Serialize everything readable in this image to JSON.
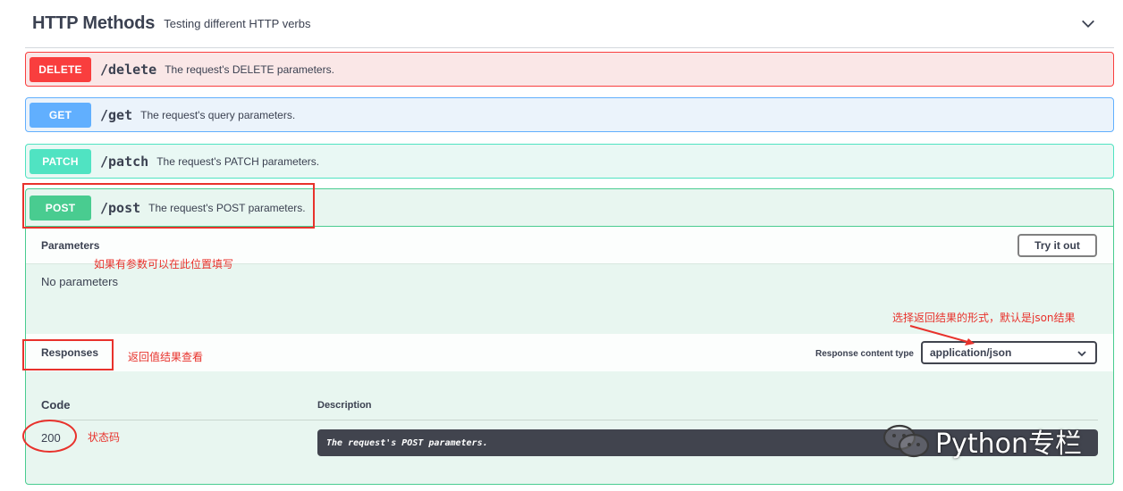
{
  "section": {
    "title": "HTTP Methods",
    "description": "Testing different HTTP verbs"
  },
  "operations": [
    {
      "method": "DELETE",
      "path": "/delete",
      "description": "The request's DELETE parameters.",
      "color": "#f93e3e"
    },
    {
      "method": "GET",
      "path": "/get",
      "description": "The request's query parameters.",
      "color": "#61affe"
    },
    {
      "method": "PATCH",
      "path": "/patch",
      "description": "The request's PATCH parameters.",
      "color": "#50e3c2"
    },
    {
      "method": "POST",
      "path": "/post",
      "description": "The request's POST parameters.",
      "color": "#49cc90"
    }
  ],
  "post_panel": {
    "parameters_title": "Parameters",
    "try_button": "Try it out",
    "no_parameters": "No parameters",
    "responses_title": "Responses",
    "response_content_type_label": "Response content type",
    "content_type_selected": "application/json",
    "table": {
      "code_header": "Code",
      "description_header": "Description",
      "rows": [
        {
          "code": "200",
          "description": "The request's POST parameters."
        }
      ]
    }
  },
  "annotations": {
    "params_note": "如果有参数可以在此位置填写",
    "content_type_note": "选择返回结果的形式，默认是json结果",
    "responses_note": "返回值结果查看",
    "status_code_note": "状态码",
    "color": "#e8322c"
  },
  "watermark": {
    "text": "Python专栏"
  }
}
